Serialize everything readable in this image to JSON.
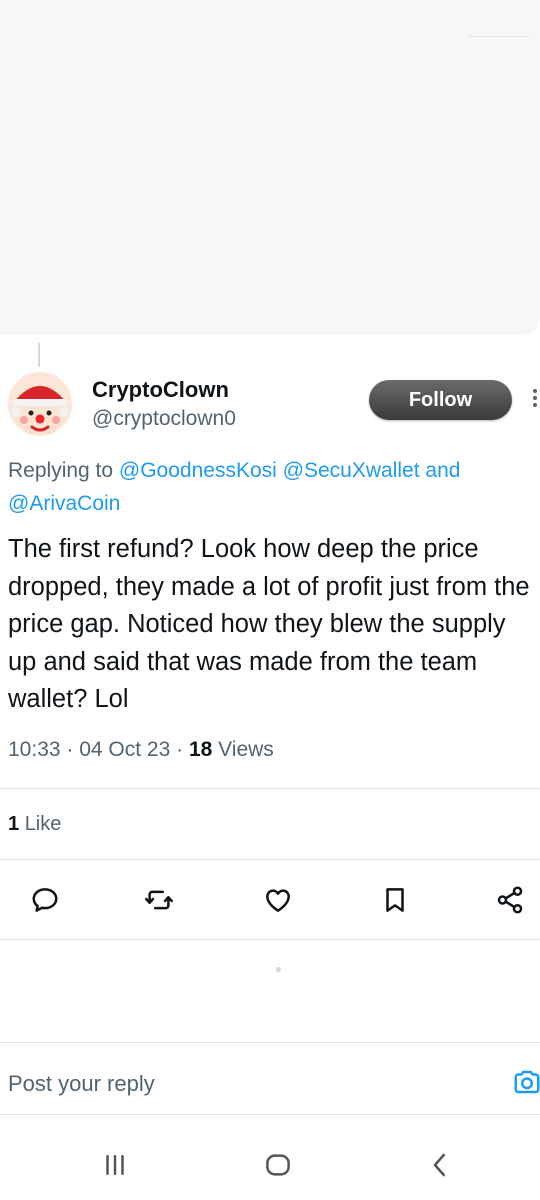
{
  "tweet": {
    "display_name": "CryptoClown",
    "handle": "@cryptoclown0",
    "follow_label": "Follow",
    "replying_to_prefix": "Replying to",
    "replying_to_mentions": [
      "@GoodnessKosi",
      "@SecuXwallet",
      "@ArivaCoin"
    ],
    "replying_to_and": "and",
    "text": "The first refund? Look how deep the price dropped, they made a lot of profit just from the price gap. Noticed how they blew the supply up and said that was made from the team wallet? Lol",
    "time": "10:33",
    "date": "04 Oct 23",
    "views_count": "18",
    "views_label": "Views",
    "likes_count": "1",
    "likes_label": "Like"
  },
  "actions": [
    {
      "name": "reply",
      "icon": "reply-icon"
    },
    {
      "name": "retweet",
      "icon": "retweet-icon"
    },
    {
      "name": "like",
      "icon": "heart-icon"
    },
    {
      "name": "bookmark",
      "icon": "bookmark-icon"
    },
    {
      "name": "share",
      "icon": "share-icon"
    }
  ],
  "reply_bar": {
    "placeholder": "Post your reply",
    "camera_icon": "camera-icon"
  },
  "system_nav": {
    "recents_icon": "recents-icon",
    "home_icon": "home-icon",
    "back_icon": "back-icon"
  },
  "colors": {
    "accent": "#1d9bf0",
    "text_primary": "#0f1419",
    "text_secondary": "#536471",
    "follow_button": "#3a3a3a"
  }
}
